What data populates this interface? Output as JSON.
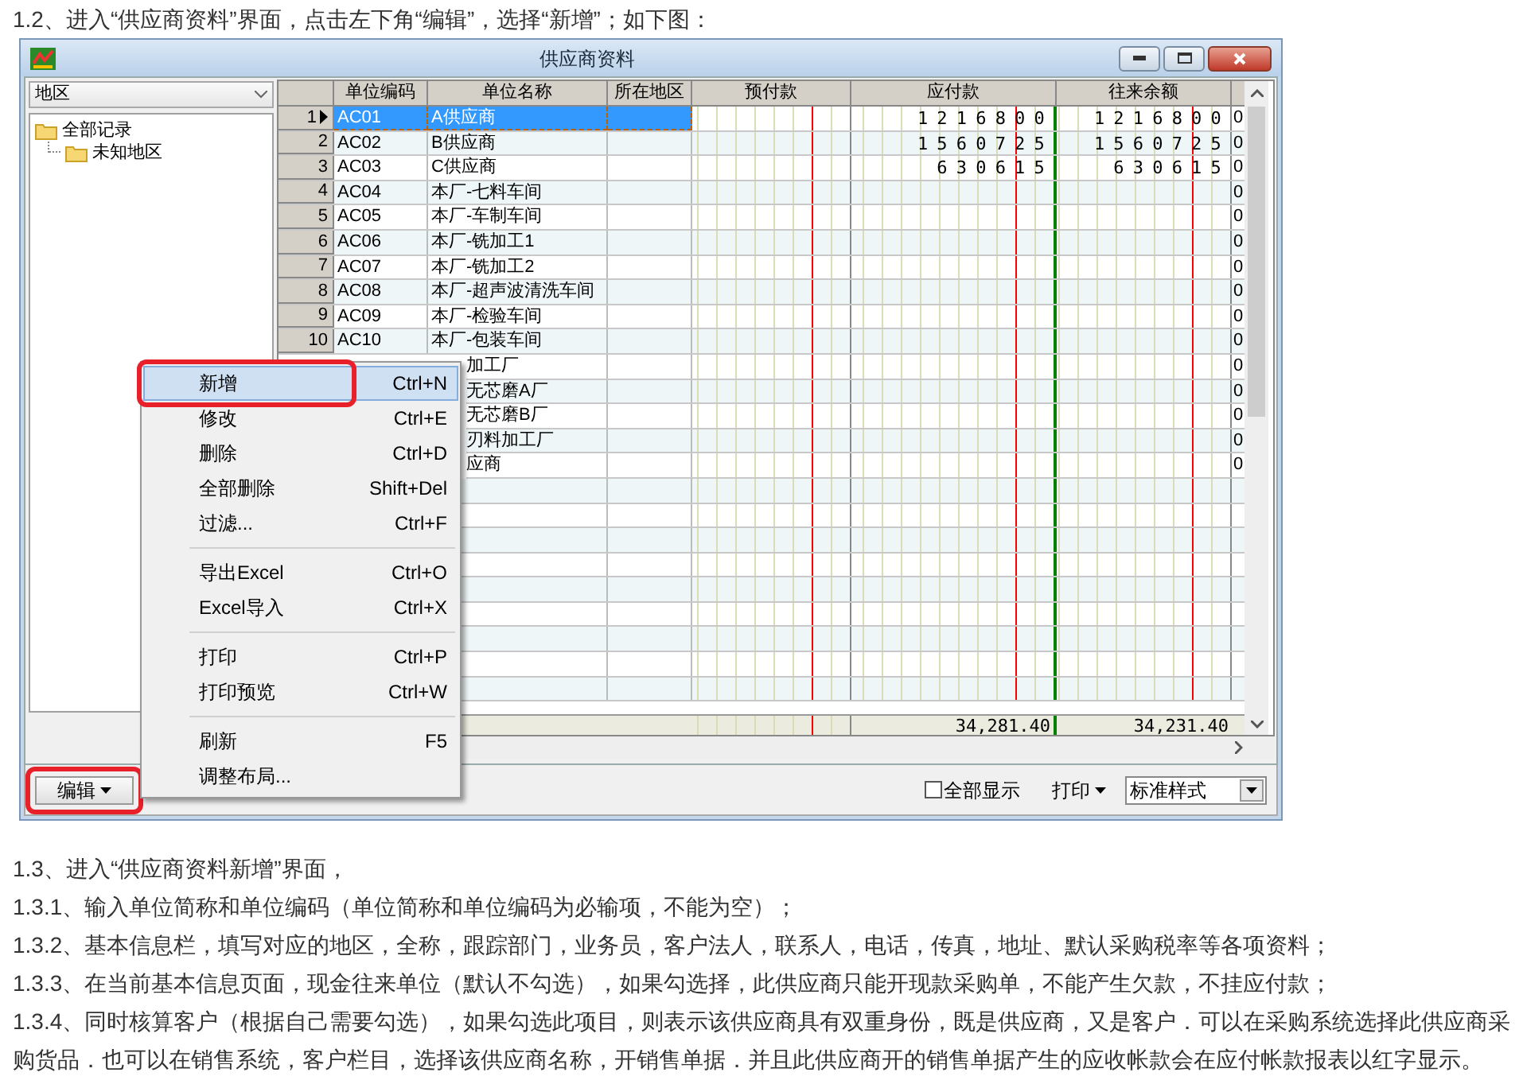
{
  "intro": "1.2、进入“供应商资料”界面，点击左下角“编辑”，选择“新增”；如下图：",
  "window": {
    "title": "供应商资料"
  },
  "region_select": {
    "value": "地区"
  },
  "tree": [
    {
      "label": "全部记录",
      "children": [
        {
          "label": "未知地区"
        }
      ]
    }
  ],
  "table": {
    "columns": [
      "单位编码",
      "单位名称",
      "所在地区",
      "预付款",
      "应付款",
      "往来余额"
    ],
    "rows": [
      {
        "num": "1",
        "code": "AC01",
        "name": "A供应商",
        "payable": "1216800",
        "balance": "1216800",
        "column_9": "0",
        "selected": true
      },
      {
        "num": "2",
        "code": "AC02",
        "name": "B供应商",
        "payable": "1560725",
        "balance": "1560725",
        "column_9": "0",
        "selected": false
      },
      {
        "num": "3",
        "code": "AC03",
        "name": "C供应商",
        "payable": "630615",
        "balance": "630615",
        "column_9": "0",
        "selected": false
      },
      {
        "num": "4",
        "code": "AC04",
        "name": "本厂-七料车间",
        "column_9": "0",
        "selected": false
      },
      {
        "num": "5",
        "code": "AC05",
        "name": "本厂-车制车间",
        "column_9": "0",
        "selected": false
      },
      {
        "num": "6",
        "code": "AC06",
        "name": "本厂-铣加工1",
        "column_9": "0",
        "selected": false
      },
      {
        "num": "7",
        "code": "AC07",
        "name": "本厂-铣加工2",
        "column_9": "0",
        "selected": false
      },
      {
        "num": "8",
        "code": "AC08",
        "name": "本厂-超声波清洗车间",
        "column_9": "0",
        "selected": false
      },
      {
        "num": "9",
        "code": "AC09",
        "name": "本厂-检验车间",
        "column_9": "0",
        "selected": false
      },
      {
        "num": "10",
        "code": "AC10",
        "name": "本厂-包装车间",
        "column_9": "0",
        "selected": false
      },
      {
        "name": "加工厂",
        "column_9": "0",
        "selected": false
      },
      {
        "name": "无芯磨A厂",
        "column_9": "0",
        "selected": false
      },
      {
        "name": "无芯磨B厂",
        "column_9": "0",
        "selected": false
      },
      {
        "name": "刃料加工厂",
        "column_9": "0",
        "selected": false
      },
      {
        "name": "应商",
        "column_9": "0",
        "selected": false
      }
    ],
    "totals": {
      "payable": "34,281.40",
      "balance": "34,231.40"
    }
  },
  "edit_button": {
    "label": "编辑",
    "highlighted": true
  },
  "show_all": {
    "label": "全部显示",
    "checked": false
  },
  "print_button": {
    "label": "打印"
  },
  "style_select": {
    "value": "标准样式"
  },
  "menu": [
    {
      "kind": "item",
      "label": "新增",
      "shortcut": "Ctrl+N",
      "highlighted": true
    },
    {
      "kind": "item",
      "label": "修改",
      "shortcut": "Ctrl+E",
      "highlighted": false
    },
    {
      "kind": "item",
      "label": "删除",
      "shortcut": "Ctrl+D",
      "highlighted": false
    },
    {
      "kind": "item",
      "label": "全部删除",
      "shortcut": "Shift+Del",
      "highlighted": false
    },
    {
      "kind": "item",
      "label": "过滤...",
      "shortcut": "Ctrl+F",
      "highlighted": false
    },
    {
      "kind": "separator"
    },
    {
      "kind": "item",
      "label": "导出Excel",
      "shortcut": "Ctrl+O",
      "highlighted": false
    },
    {
      "kind": "item",
      "label": "Excel导入",
      "shortcut": "Ctrl+X",
      "highlighted": false
    },
    {
      "kind": "separator"
    },
    {
      "kind": "item",
      "label": "打印",
      "shortcut": "Ctrl+P",
      "highlighted": false
    },
    {
      "kind": "item",
      "label": "打印预览",
      "shortcut": "Ctrl+W",
      "highlighted": false
    },
    {
      "kind": "separator"
    },
    {
      "kind": "item",
      "label": "刷新",
      "shortcut": "F5",
      "highlighted": false
    },
    {
      "kind": "item",
      "label": "调整布局...",
      "highlighted": false
    }
  ],
  "paragraphs": [
    "1.3、进入“供应商资料新增”界面，",
    "1.3.1、输入单位简称和单位编码（单位简称和单位编码为必输项，不能为空）；",
    "1.3.2、基本信息栏，填写对应的地区，全称，跟踪部门，业务员，客户法人，联系人，电话，传真，地址、默认采购税率等各项资料；",
    "1.3.3、在当前基本信息页面，现金往来单位（默认不勾选），如果勾选择，此供应商只能开现款采购单，不能产生欠款，不挂应付款；",
    "1.3.4、同时核算客户（根据自己需要勾选），如果勾选此项目，则表示该供应商具有双重身份，既是供应商，又是客户．可以在采购系统选择此供应商采购货品．也可以在销售系统，客户栏目，选择该供应商名称，开销售单据．并且此供应商开的销售单据产生的应收帐款会在应付帐款报表以红字显示。"
  ]
}
